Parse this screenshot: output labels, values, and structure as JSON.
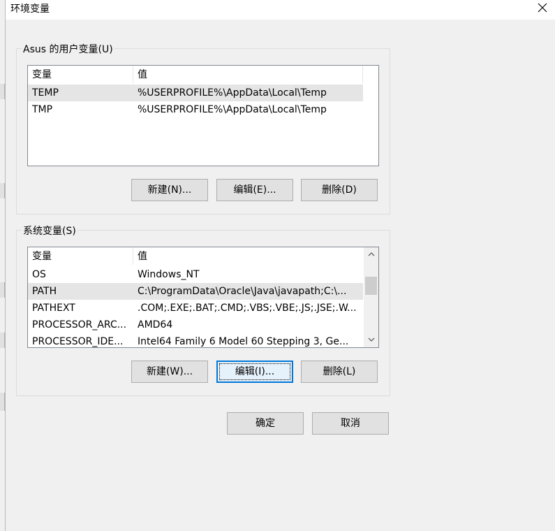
{
  "window": {
    "title": "环境变量"
  },
  "user_group": {
    "legend": "Asus 的用户变量(U)",
    "columns": [
      "变量",
      "值"
    ],
    "rows": [
      {
        "name": "TEMP",
        "value": "%USERPROFILE%\\AppData\\Local\\Temp",
        "selected": true
      },
      {
        "name": "TMP",
        "value": "%USERPROFILE%\\AppData\\Local\\Temp",
        "selected": false
      }
    ],
    "buttons": {
      "new": "新建(N)...",
      "edit": "编辑(E)...",
      "delete": "删除(D)"
    }
  },
  "system_group": {
    "legend": "系统变量(S)",
    "columns": [
      "变量",
      "值"
    ],
    "rows": [
      {
        "name": "OS",
        "value": "Windows_NT",
        "selected": false
      },
      {
        "name": "PATH",
        "value": "C:\\ProgramData\\Oracle\\Java\\javapath;C:\\...",
        "selected": true
      },
      {
        "name": "PATHEXT",
        "value": ".COM;.EXE;.BAT;.CMD;.VBS;.VBE;.JS;.JSE;.W...",
        "selected": false
      },
      {
        "name": "PROCESSOR_ARC...",
        "value": "AMD64",
        "selected": false
      },
      {
        "name": "PROCESSOR_IDE...",
        "value": "Intel64 Family 6 Model 60 Stepping 3, Ge...",
        "selected": false
      }
    ],
    "buttons": {
      "new": "新建(W)...",
      "edit": "编辑(I)...",
      "delete": "删除(L)"
    }
  },
  "footer": {
    "ok": "确定",
    "cancel": "取消"
  },
  "colors": {
    "selection": "#e5e5e5",
    "focus_border": "#0078d7",
    "button_face": "#e1e1e1",
    "dialog_bg": "#f0f0f0"
  },
  "icons": {
    "close": "close-icon",
    "scroll_up": "chevron-up-icon",
    "scroll_down": "chevron-down-icon"
  }
}
